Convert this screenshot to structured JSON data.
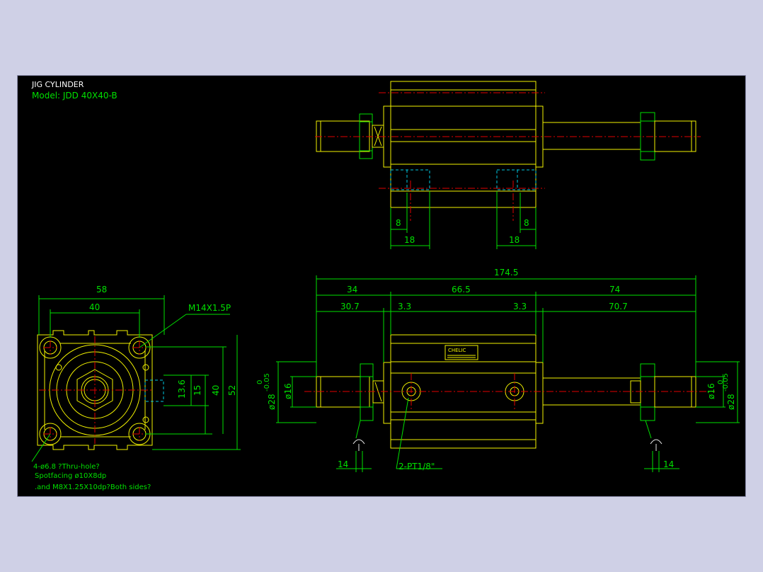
{
  "title": "JIG CYLINDER",
  "model": "Model: JDD 40X40-B",
  "dims": {
    "top_left_8": "8",
    "top_right_8": "8",
    "top_left_18": "18",
    "top_right_18": "18",
    "total": "174.5",
    "d34": "34",
    "d665": "66.5",
    "d74": "74",
    "d307": "30.7",
    "d33a": "3.3",
    "d33b": "3.3",
    "d707": "70.7",
    "d58": "58",
    "d40w": "40",
    "m14": "M14X1.5P",
    "d136": "13.6",
    "d15": "15",
    "d40h": "40",
    "d52": "52",
    "phi16_left": "ø16",
    "phi16_right": "ø16",
    "phi28_left": "ø28",
    "phi28_right": "ø28",
    "tol_left": "-0.05",
    "tol_right": "-0.05",
    "tol0_left": "0",
    "tol0_right": "0",
    "d14_left": "14",
    "d14_right": "14",
    "port": "2-PT1/8\""
  },
  "notes": {
    "holes": "4-ø6.8 ?Thru-hole?",
    "spot": "Spotfacing  ø10X8dp",
    "tap": ".and M8X1.25X10dp?Both sides?"
  },
  "label_plate": "CHELIC",
  "colors": {
    "background": "#000000",
    "outline": "#f2f200",
    "dimension": "#00e000",
    "center": "#e00000",
    "hidden": "#00c8e0"
  }
}
